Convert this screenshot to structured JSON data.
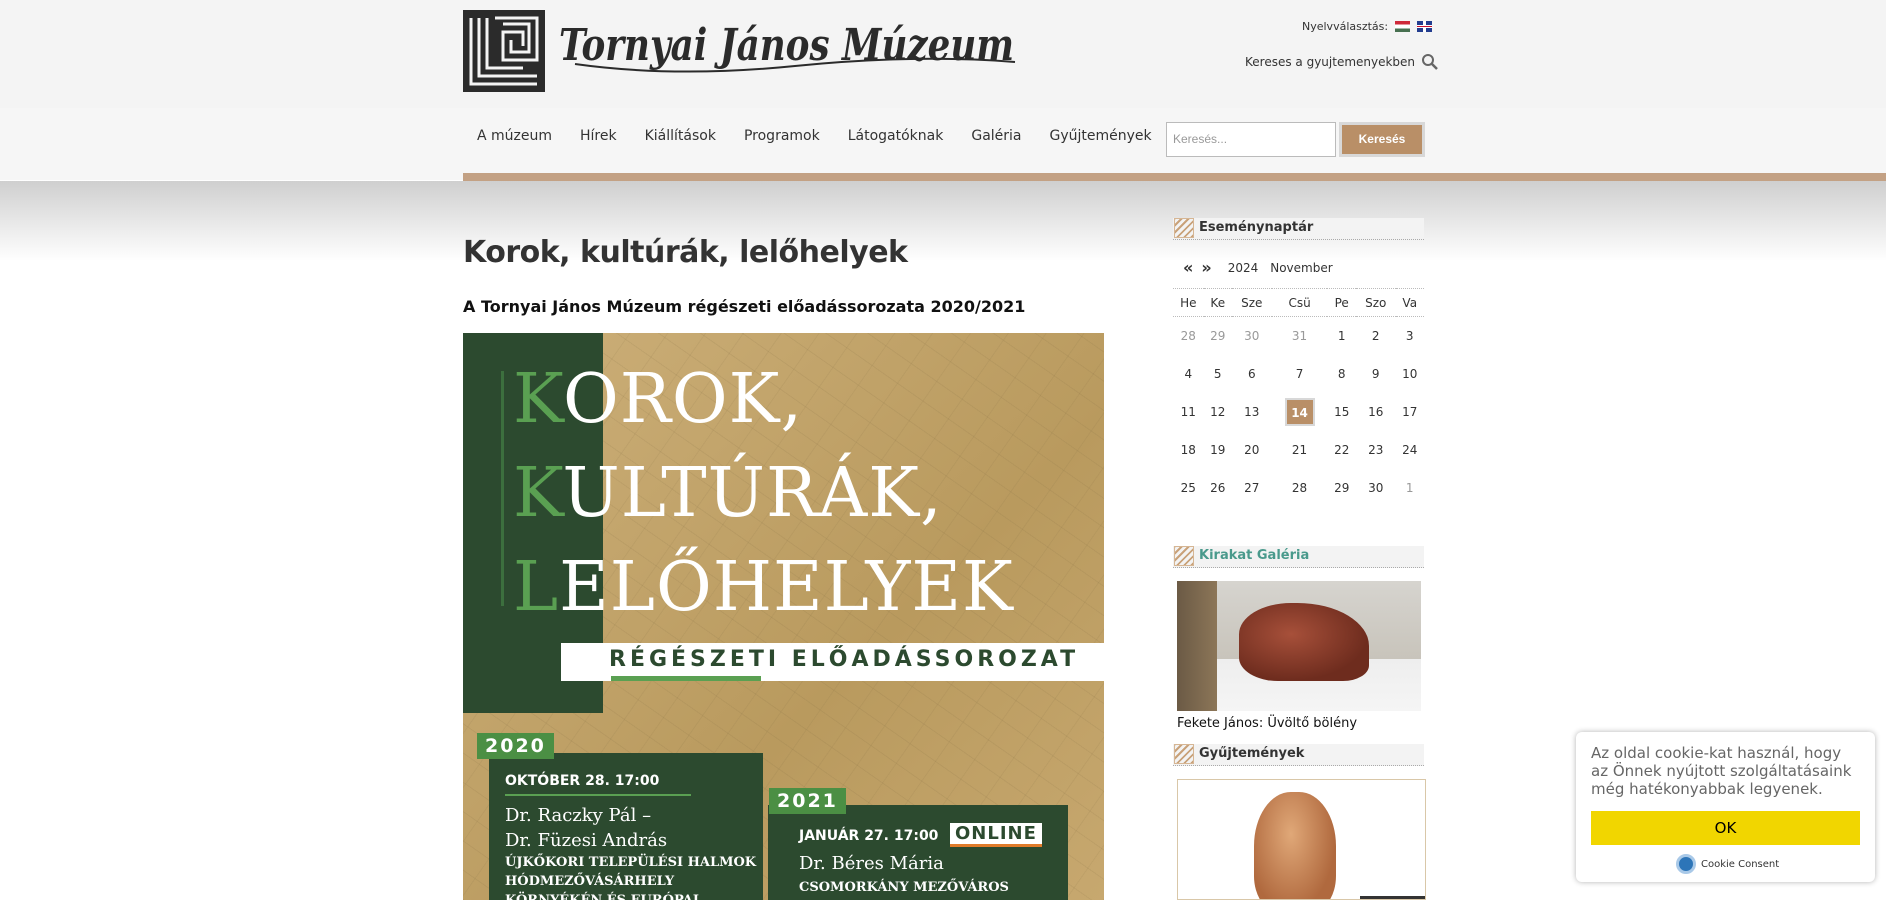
{
  "header": {
    "logo_text": "Tornyai János Múzeum",
    "lang_label": "Nyelvválasztás:",
    "languages": [
      "magyar",
      "english"
    ],
    "collection_search": "Kereses a gyujtemenyekben"
  },
  "nav": {
    "items": [
      "A múzeum",
      "Hírek",
      "Kiállítások",
      "Programok",
      "Látogatóknak",
      "Galéria",
      "Gyűjtemények"
    ],
    "search_placeholder": "Keresés...",
    "search_button": "Keresés"
  },
  "main": {
    "title": "Korok, kultúrák, lelőhelyek",
    "subtitle": "A Tornyai János Múzeum régészeti előadássorozata 2020/2021",
    "poster": {
      "line1_first": "K",
      "line1_rest": "OROK,",
      "line2_first": "K",
      "line2_rest": "ULTÚRÁK,",
      "line3_first": "L",
      "line3_rest": "ELŐHELYEK",
      "band": "RÉGÉSZETI ELŐADÁSSOROZAT",
      "year1": "2020",
      "event1_date": "OKTÓBER 28. 17:00",
      "event1_name1": "Dr. Raczky Pál –",
      "event1_name2": "Dr. Füzesi András",
      "event1_sub1": "ÚJKŐKORI TELEPÜLÉSI HALMOK",
      "event1_sub2": "HÓDMEZŐVÁSÁRHELY",
      "event1_sub3": "KÖRNYÉKÉN ÉS EURÓPAI",
      "year2": "2021",
      "event2_date": "JANUÁR 27. 17:00",
      "event2_online": "ONLINE",
      "event2_name": "Dr. Béres Mária",
      "event2_sub": "CSOMORKÁNY MEZŐVÁROS"
    }
  },
  "sidebar": {
    "calendar_title": "Eseménynaptár",
    "calendar_prev": "«",
    "calendar_next": "»",
    "calendar_year": "2024",
    "calendar_month": "November",
    "weekdays": [
      "He",
      "Ke",
      "Sze",
      "Csü",
      "Pe",
      "Szo",
      "Va"
    ],
    "weeks": [
      [
        "28",
        "29",
        "30",
        "31",
        "1",
        "2",
        "3"
      ],
      [
        "4",
        "5",
        "6",
        "7",
        "8",
        "9",
        "10"
      ],
      [
        "11",
        "12",
        "13",
        "14",
        "15",
        "16",
        "17"
      ],
      [
        "18",
        "19",
        "20",
        "21",
        "22",
        "23",
        "24"
      ],
      [
        "25",
        "26",
        "27",
        "28",
        "29",
        "30",
        "1"
      ]
    ],
    "today": "14",
    "gallery_title": "Kirakat Galéria",
    "gallery_caption": "Fekete János: Üvöltő bölény",
    "collections_title": "Gyűjtemények"
  },
  "cookie": {
    "message": "Az oldal cookie-kat használ, hogy az Önnek nyújtott szolgáltatásaink még hatékonyabbak legyenek.",
    "ok": "OK",
    "brand": "Cookie Consent"
  },
  "colors": {
    "accent": "#b98f67",
    "poster_green": "#2c4a2f",
    "poster_light_green": "#5aa052",
    "cookie_button": "#f1d600"
  }
}
